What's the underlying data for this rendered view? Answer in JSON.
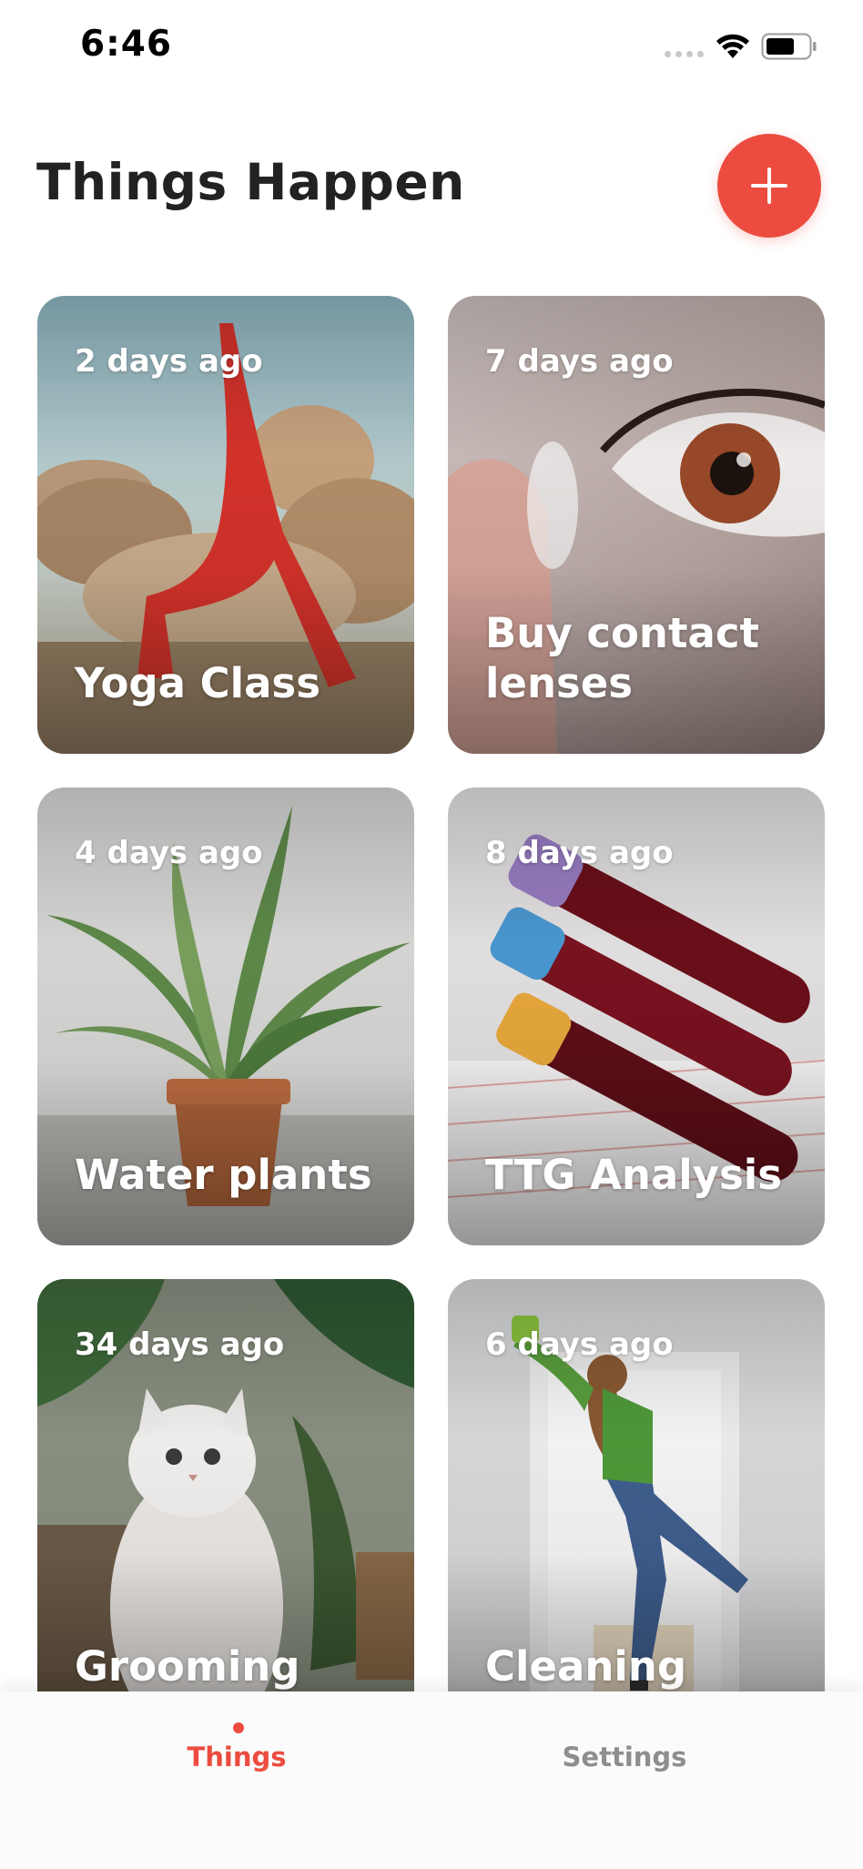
{
  "status_bar": {
    "time": "6:46"
  },
  "header": {
    "title": "Things Happen",
    "add_icon": "plus-icon"
  },
  "cards": [
    {
      "ago": "2 days ago",
      "title": "Yoga Class",
      "image": "yoga-photo"
    },
    {
      "ago": "7 days ago",
      "title": "Buy contact lenses",
      "image": "eye-contact-lens-photo"
    },
    {
      "ago": "4 days ago",
      "title": "Water plants",
      "image": "potted-plant-photo"
    },
    {
      "ago": "8 days ago",
      "title": "TTG Analysis",
      "image": "blood-test-tubes-photo"
    },
    {
      "ago": "34 days ago",
      "title": "Grooming",
      "image": "white-cat-photo"
    },
    {
      "ago": "6 days ago",
      "title": "Cleaning",
      "image": "woman-cleaning-photo"
    }
  ],
  "tab_bar": {
    "things_label": "Things",
    "settings_label": "Settings",
    "active": "Things"
  },
  "colors": {
    "accent": "#ec4c3f",
    "inactive_tab": "#8e8e8e",
    "title_text": "#222222"
  }
}
